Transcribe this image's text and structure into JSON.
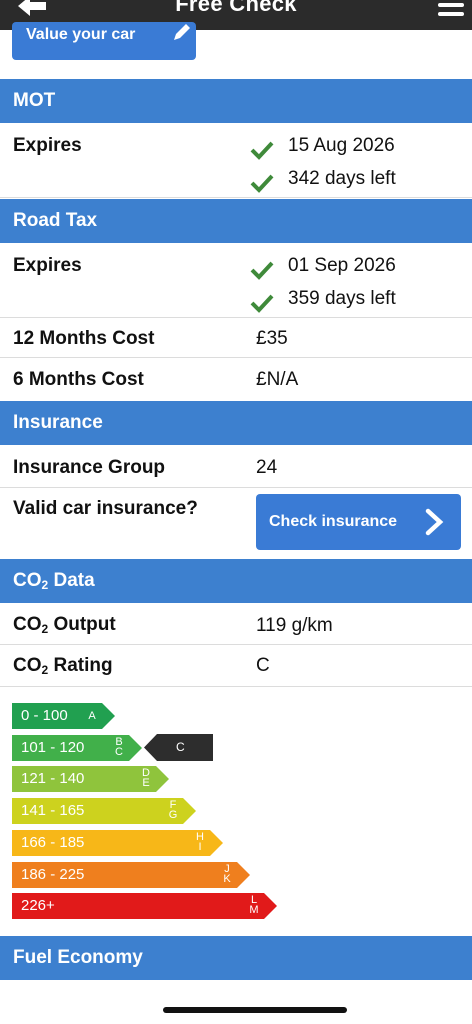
{
  "header": {
    "title": "Free Check"
  },
  "value_button": {
    "label": "Value your car"
  },
  "mot": {
    "heading": "MOT",
    "expires_label": "Expires",
    "expires_date": "15 Aug 2026",
    "days_left": "342 days left"
  },
  "road_tax": {
    "heading": "Road Tax",
    "expires_label": "Expires",
    "expires_date": "01 Sep 2026",
    "days_left": "359 days left",
    "cost_12_label": "12 Months Cost",
    "cost_12_value": "£35",
    "cost_6_label": "6 Months Cost",
    "cost_6_value": "£N/A"
  },
  "insurance": {
    "heading": "Insurance",
    "group_label": "Insurance Group",
    "group_value": "24",
    "valid_label": "Valid car insurance?",
    "check_button": "Check insurance"
  },
  "co2": {
    "heading_main": "CO",
    "heading_sub": "2",
    "heading_tail": " Data",
    "output_label_main": "CO",
    "output_label_sub": "2",
    "output_label_tail": " Output",
    "output_value": "119 g/km",
    "rating_label_main": "CO",
    "rating_label_sub": "2",
    "rating_label_tail": " Rating",
    "rating_value": "C",
    "current_badge": "C",
    "bands": [
      {
        "range": "0 - 100",
        "letters": [
          "A"
        ],
        "color": "#21a050"
      },
      {
        "range": "101 - 120",
        "letters": [
          "B",
          "C"
        ],
        "color": "#41b04a"
      },
      {
        "range": "121 - 140",
        "letters": [
          "D",
          "E"
        ],
        "color": "#8fc43c"
      },
      {
        "range": "141 - 165",
        "letters": [
          "F",
          "G"
        ],
        "color": "#cdd21e"
      },
      {
        "range": "166 - 185",
        "letters": [
          "H",
          "I"
        ],
        "color": "#f7b718"
      },
      {
        "range": "186 - 225",
        "letters": [
          "J",
          "K"
        ],
        "color": "#ef7f1e"
      },
      {
        "range": "226+",
        "letters": [
          "L",
          "M"
        ],
        "color": "#e11a1a"
      }
    ]
  },
  "fuel": {
    "heading": "Fuel Economy"
  }
}
